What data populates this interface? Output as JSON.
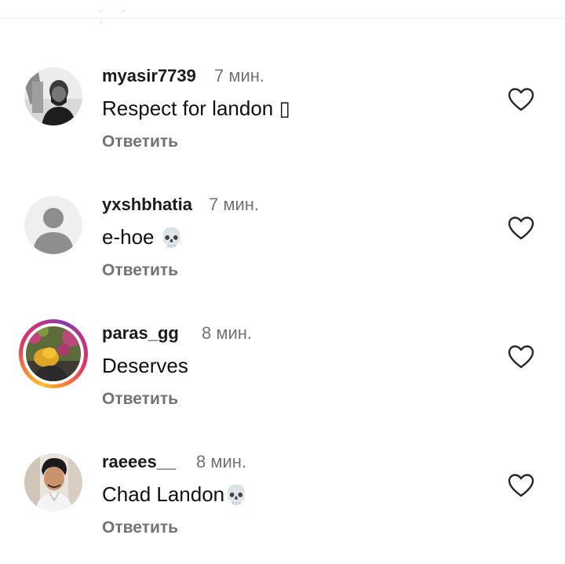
{
  "comments": [
    {
      "username": "myasir7739",
      "time": "7 мин.",
      "text": "Respect for landon ",
      "trailing_glyph": "▯",
      "reply_label": "Ответить",
      "avatar": "photo-man-beard-grayscale"
    },
    {
      "username": "yxshbhatia",
      "time": "7 мин.",
      "text": "e-hoe ",
      "trailing_glyph": "💀",
      "reply_label": "Ответить",
      "avatar": "default-user-icon"
    },
    {
      "username": "paras_gg",
      "time": "8 мин.",
      "text": "Deserves",
      "trailing_glyph": "",
      "reply_label": "Ответить",
      "avatar": "photo-person-yellow-turban-flowers",
      "has_story_ring": true
    },
    {
      "username": "raeees__",
      "time": "8 мин.",
      "text": "Chad Landon",
      "trailing_glyph": "💀",
      "reply_label": "Ответить",
      "avatar": "photo-young-man"
    }
  ],
  "colors": {
    "username": "#1b1b1b",
    "meta": "#737373",
    "divider": "#ececec",
    "story_ring": [
      "#fbc02d",
      "#f77737",
      "#e1306c",
      "#c13584",
      "#833ab4"
    ]
  },
  "icons": {
    "like": "heart-outline-icon",
    "default_avatar": "person-silhouette-icon"
  }
}
